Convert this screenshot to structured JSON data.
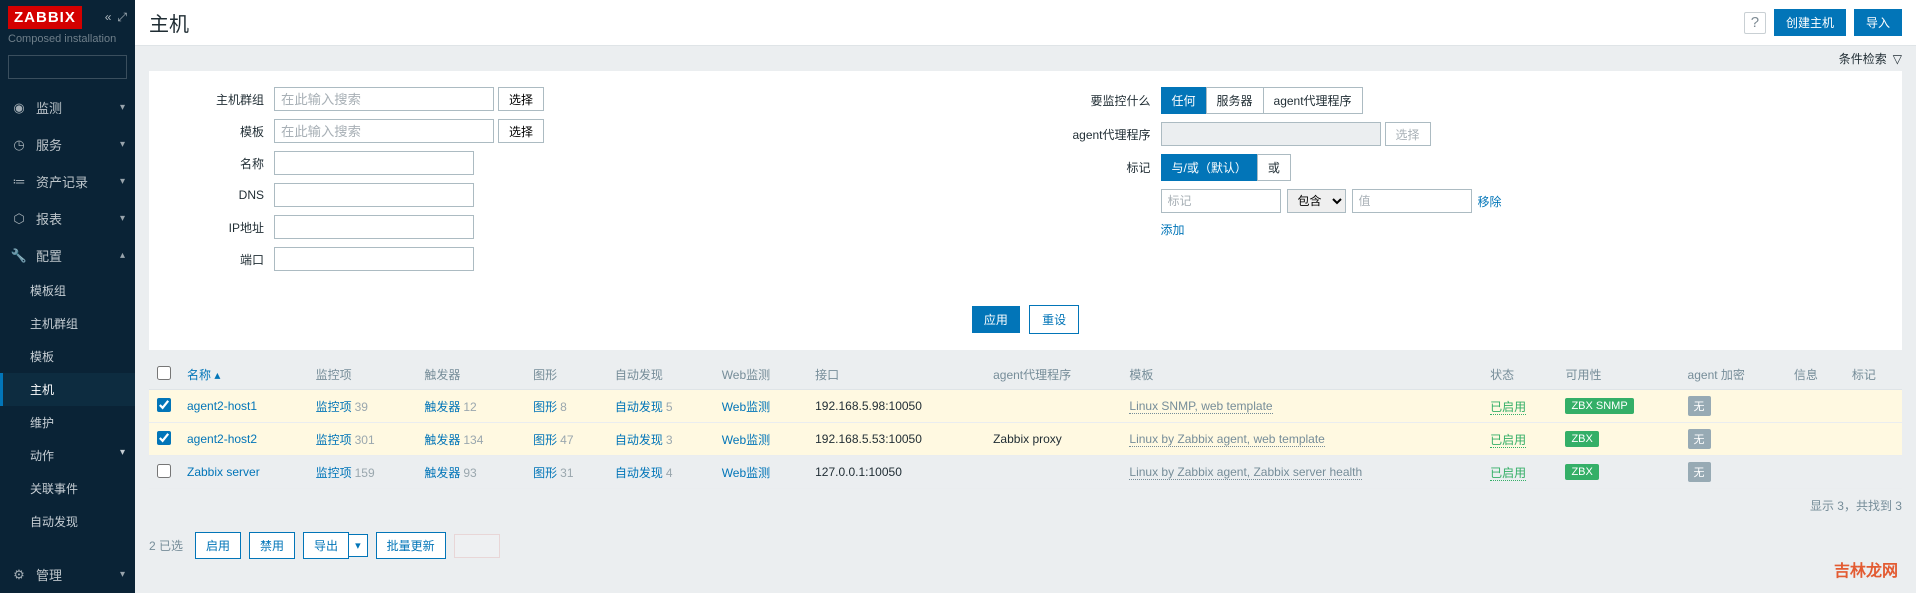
{
  "brand": "ZABBIX",
  "installation": "Composed installation",
  "sidebar": {
    "nav": [
      {
        "icon": "◉",
        "label": "监测"
      },
      {
        "icon": "◷",
        "label": "服务"
      },
      {
        "icon": "≔",
        "label": "资产记录"
      },
      {
        "icon": "⬡",
        "label": "报表"
      },
      {
        "icon": "🔧",
        "label": "配置"
      }
    ],
    "sub": [
      {
        "label": "模板组"
      },
      {
        "label": "主机群组"
      },
      {
        "label": "模板"
      },
      {
        "label": "主机",
        "active": true
      },
      {
        "label": "维护"
      },
      {
        "label": "动作"
      },
      {
        "label": "关联事件"
      },
      {
        "label": "自动发现"
      }
    ],
    "admin": {
      "icon": "⚙",
      "label": "管理"
    }
  },
  "header": {
    "title": "主机",
    "create": "创建主机",
    "import": "导入"
  },
  "filter_toolbar": {
    "expand": "条件检索"
  },
  "filter": {
    "hostgroup_label": "主机群组",
    "template_label": "模板",
    "name_label": "名称",
    "dns_label": "DNS",
    "ip_label": "IP地址",
    "port_label": "端口",
    "placeholder": "在此输入搜索",
    "select": "选择",
    "monitor_label": "要监控什么",
    "proxy_label": "agent代理程序",
    "tag_label": "标记",
    "monitor_opts": [
      "任何",
      "服务器",
      "agent代理程序"
    ],
    "tag_opts": [
      "与/或（默认）",
      "或"
    ],
    "tag_ph": "标记",
    "tag_op": "包含",
    "val_ph": "值",
    "remove": "移除",
    "add": "添加",
    "apply": "应用",
    "reset": "重设"
  },
  "table": {
    "cols": {
      "name": "名称",
      "items": "监控项",
      "triggers": "触发器",
      "graphs": "图形",
      "discovery": "自动发现",
      "web": "Web监测",
      "interface": "接口",
      "proxy": "agent代理程序",
      "template": "模板",
      "status": "状态",
      "avail": "可用性",
      "encrypt": "agent 加密",
      "info": "信息",
      "tags": "标记"
    },
    "items_label": "监控项",
    "triggers_label": "触发器",
    "graphs_label": "图形",
    "discovery_label": "自动发现",
    "web_label": "Web监测",
    "status_enabled": "已启用",
    "rows": [
      {
        "checked": true,
        "name": "agent2-host1",
        "items": 39,
        "triggers": 12,
        "graphs": 8,
        "discovery": 5,
        "interface": "192.168.5.98:10050",
        "proxy": "",
        "templates": "Linux SNMP, web template",
        "avail": "ZBX  SNMP",
        "avail_class": "badge-green",
        "encrypt": "无"
      },
      {
        "checked": true,
        "name": "agent2-host2",
        "items": 301,
        "triggers": 134,
        "graphs": 47,
        "discovery": 3,
        "interface": "192.168.5.53:10050",
        "proxy": "Zabbix proxy",
        "templates": "Linux by Zabbix agent, web template",
        "avail": "ZBX",
        "avail_class": "badge-green",
        "encrypt": "无"
      },
      {
        "checked": false,
        "name": "Zabbix server",
        "items": 159,
        "triggers": 93,
        "graphs": 31,
        "discovery": 4,
        "interface": "127.0.0.1:10050",
        "proxy": "",
        "templates": "Linux by Zabbix agent, Zabbix server health",
        "avail": "ZBX",
        "avail_class": "badge-green",
        "encrypt": "无"
      }
    ]
  },
  "footer": "显示 3，共找到 3",
  "bulk": {
    "count": "2 已选",
    "enable": "启用",
    "disable": "禁用",
    "export": "导出",
    "mass": "批量更新",
    "delete": ""
  },
  "watermark": "吉林龙网"
}
